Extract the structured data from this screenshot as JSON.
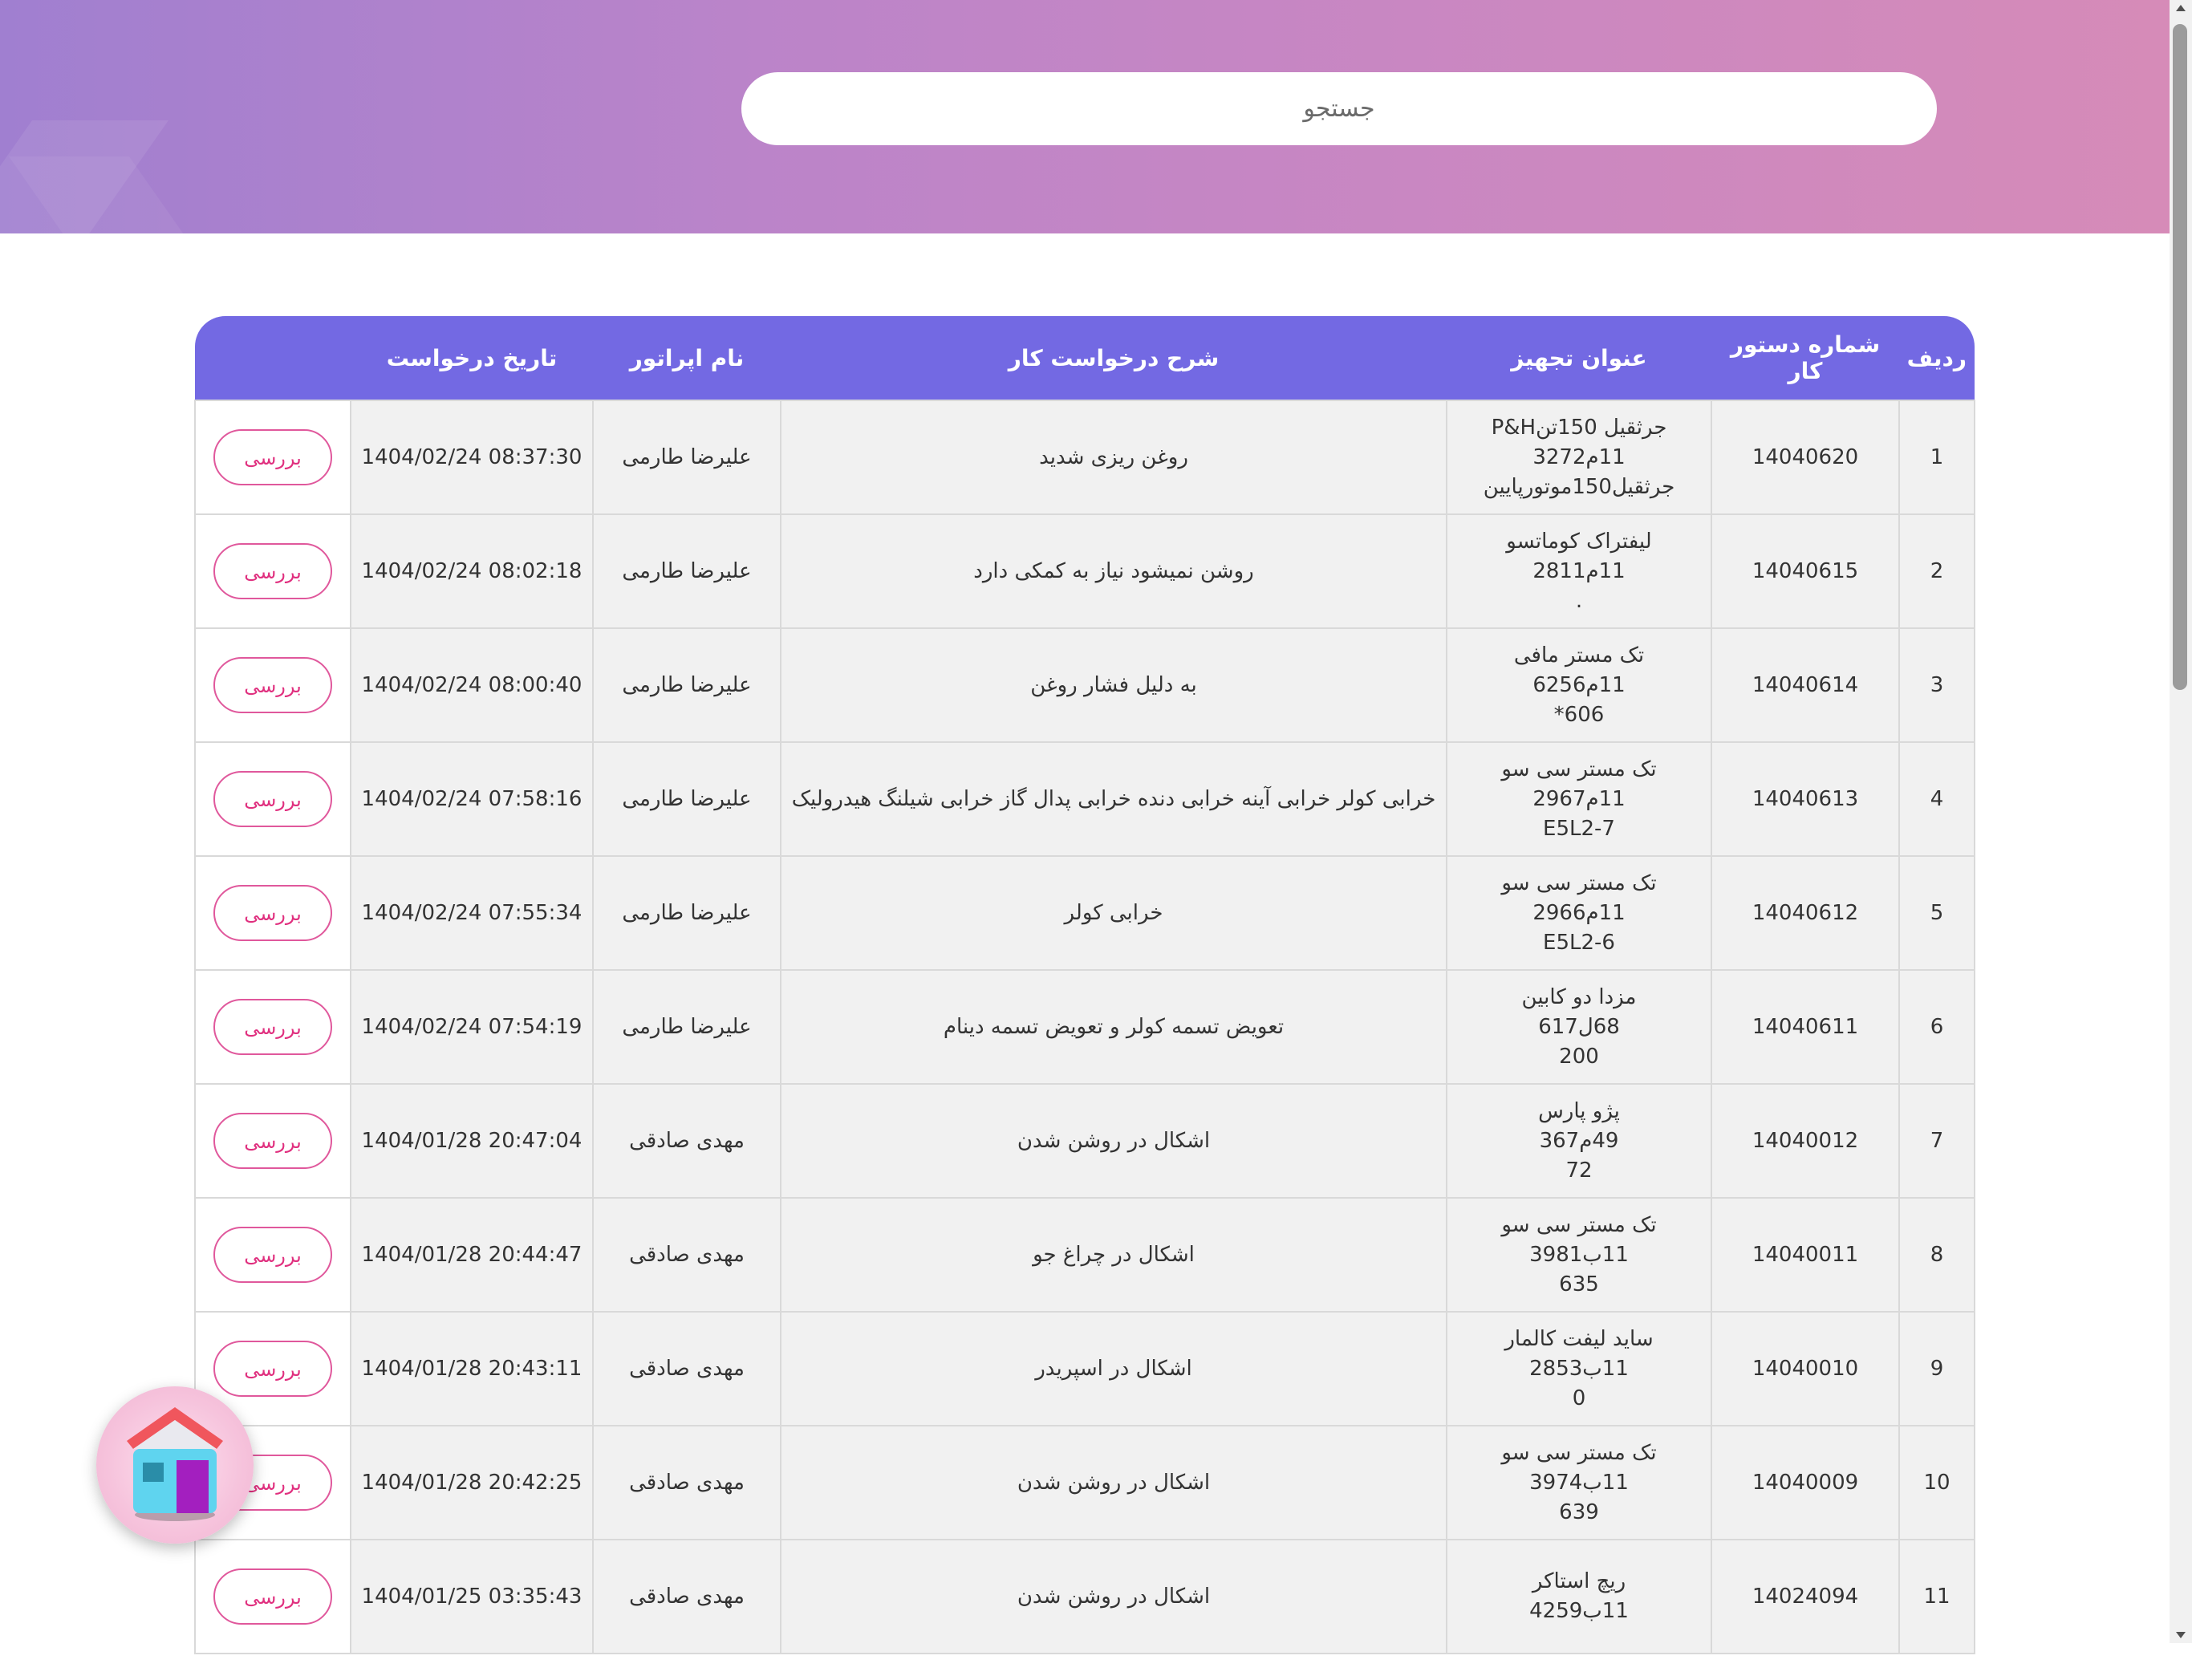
{
  "search": {
    "placeholder": "جستجو"
  },
  "table": {
    "headers": {
      "row": "ردیف",
      "order_no": "شماره دستور کار",
      "equipment": "عنوان تجهیز",
      "description": "شرح درخواست کار",
      "operator": "نام اپراتور",
      "date": "تاریخ درخواست",
      "action": ""
    },
    "rows": [
      {
        "row": "1",
        "order_no": "14040620",
        "eq1": "جرثقیل 150تنP&H",
        "eq2": "11م3272",
        "eq3": "جرثقیل150موتورپایین",
        "description": "روغن ریزی شدید",
        "operator": "علیرضا طارمی",
        "date": "1404/02/24 08:37:30",
        "action": "بررسی"
      },
      {
        "row": "2",
        "order_no": "14040615",
        "eq1": "لیفتراک کوماتسو",
        "eq2": "11م2811",
        "eq3": ".",
        "description": "روشن نمیشود نیاز به کمکی دارد",
        "operator": "علیرضا طارمی",
        "date": "1404/02/24 08:02:18",
        "action": "بررسی"
      },
      {
        "row": "3",
        "order_no": "14040614",
        "eq1": "تک مستر مافی",
        "eq2": "11م6256",
        "eq3": "606*",
        "description": "به دلیل فشار روغن",
        "operator": "علیرضا طارمی",
        "date": "1404/02/24 08:00:40",
        "action": "بررسی"
      },
      {
        "row": "4",
        "order_no": "14040613",
        "eq1": "تک مستر سی سو",
        "eq2": "11م2967",
        "eq3": "E5L2-7",
        "description": "خرابی کولر خرابی آینه خرابی دنده خرابی پدال گاز خرابی شیلنگ هیدرولیک",
        "operator": "علیرضا طارمی",
        "date": "1404/02/24 07:58:16",
        "action": "بررسی"
      },
      {
        "row": "5",
        "order_no": "14040612",
        "eq1": "تک مستر سی سو",
        "eq2": "11م2966",
        "eq3": "E5L2-6",
        "description": "خرابی کولر",
        "operator": "علیرضا طارمی",
        "date": "1404/02/24 07:55:34",
        "action": "بررسی"
      },
      {
        "row": "6",
        "order_no": "14040611",
        "eq1": "مزدا دو کابین",
        "eq2": "68ل617",
        "eq3": "200",
        "description": "تعویض تسمه کولر و تعویض تسمه دینام",
        "operator": "علیرضا طارمی",
        "date": "1404/02/24 07:54:19",
        "action": "بررسی"
      },
      {
        "row": "7",
        "order_no": "14040012",
        "eq1": "پژو پارس",
        "eq2": "49م367",
        "eq3": "72",
        "description": "اشکال در روشن شدن",
        "operator": "مهدی صادقی",
        "date": "1404/01/28 20:47:04",
        "action": "بررسی"
      },
      {
        "row": "8",
        "order_no": "14040011",
        "eq1": "تک مستر سی سو",
        "eq2": "11ب3981",
        "eq3": "635",
        "description": "اشکال در چراغ جو",
        "operator": "مهدی صادقی",
        "date": "1404/01/28 20:44:47",
        "action": "بررسی"
      },
      {
        "row": "9",
        "order_no": "14040010",
        "eq1": "ساید لیفت کالمار",
        "eq2": "11ب2853",
        "eq3": "0",
        "description": "اشکال در اسپریدر",
        "operator": "مهدی صادقی",
        "date": "1404/01/28 20:43:11",
        "action": "بررسی"
      },
      {
        "row": "10",
        "order_no": "14040009",
        "eq1": "تک مستر سی سو",
        "eq2": "11ب3974",
        "eq3": "639",
        "description": "اشکال در روشن شدن",
        "operator": "مهدی صادقی",
        "date": "1404/01/28 20:42:25",
        "action": "بررسی"
      },
      {
        "row": "11",
        "order_no": "14024094",
        "eq1": "ریچ استاکر",
        "eq2": "11ب4259",
        "eq3": "",
        "description": "اشکال در روشن شدن",
        "operator": "مهدی صادقی",
        "date": "1404/01/25 03:35:43",
        "action": "بررسی"
      }
    ]
  },
  "colors": {
    "header_gradient_start": "#a07fd0",
    "header_gradient_end": "#d68bb8",
    "table_header_bg": "#7369e3",
    "button_accent": "#e0307f"
  },
  "icons": {
    "home_fab": "home-icon"
  }
}
